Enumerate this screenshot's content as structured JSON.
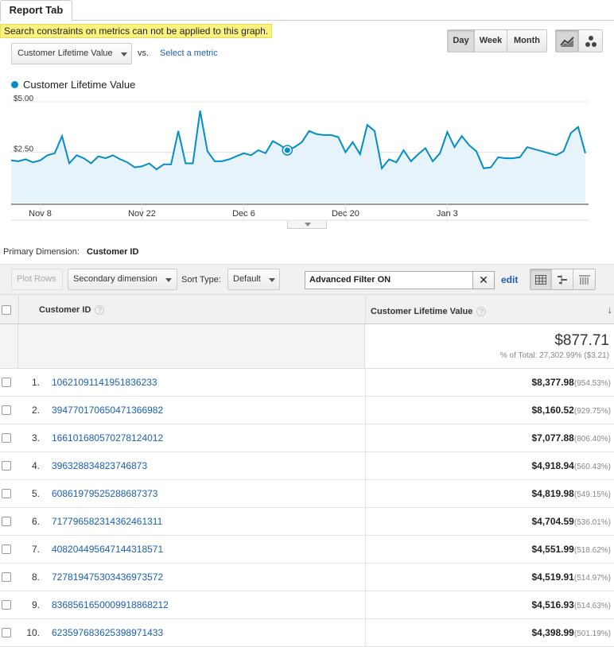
{
  "tab": {
    "label": "Report Tab"
  },
  "warning": "Search constraints on metrics can not be applied to this graph.",
  "metric_selector": {
    "value": "Customer Lifetime Value",
    "vs": "vs.",
    "select_metric": "Select a metric"
  },
  "period_buttons": [
    "Day",
    "Week",
    "Month"
  ],
  "active_period": "Day",
  "chart_type_icons": [
    "line-chart-icon",
    "motion-chart-icon"
  ],
  "legend": {
    "label": "Customer Lifetime Value",
    "color": "#058dc7"
  },
  "chart_data": {
    "type": "area",
    "y_ticks": [
      "$5.00",
      "$2.50"
    ],
    "ylim": [
      0,
      5.0
    ],
    "x_ticks": [
      "Nov 8",
      "Nov 22",
      "Dec 6",
      "Dec 20",
      "Jan 3"
    ],
    "series": [
      {
        "name": "Customer Lifetime Value",
        "color": "#058dc7",
        "values": [
          2.1,
          2.05,
          2.15,
          2.0,
          2.1,
          2.35,
          2.45,
          3.3,
          1.95,
          2.35,
          2.2,
          1.95,
          2.3,
          2.2,
          2.35,
          2.15,
          2.0,
          1.75,
          1.8,
          1.95,
          1.65,
          1.9,
          1.9,
          3.55,
          1.95,
          1.95,
          4.55,
          2.55,
          2.05,
          2.05,
          2.15,
          2.3,
          2.45,
          2.35,
          2.6,
          2.45,
          3.05,
          2.85,
          2.6,
          2.75,
          3.0,
          3.55,
          3.4,
          3.35,
          3.35,
          3.25,
          2.5,
          3.0,
          2.4,
          3.85,
          3.55,
          1.7,
          2.15,
          2.0,
          2.6,
          2.05,
          2.4,
          2.7,
          2.05,
          2.45,
          3.5,
          2.75,
          3.3,
          2.85,
          2.55,
          1.7,
          1.75,
          2.25,
          2.2,
          2.2,
          2.25,
          2.75,
          2.65,
          2.55,
          2.45,
          2.35,
          2.55,
          3.45,
          3.75,
          2.45
        ]
      }
    ],
    "highlight_index": 38
  },
  "primary_dimension": {
    "label": "Primary Dimension:",
    "value": "Customer ID"
  },
  "toolbar": {
    "plot_rows": "Plot Rows",
    "secondary_dimension": "Secondary dimension",
    "sort_type_label": "Sort Type:",
    "sort_type_value": "Default",
    "filter_value": "Advanced Filter ON",
    "filter_clear": "✕",
    "edit": "edit"
  },
  "table": {
    "col_customer_id": "Customer ID",
    "col_metric": "Customer Lifetime Value",
    "help": "?",
    "sort_arrow": "↓",
    "total_value": "$877.71",
    "total_pct": "% of Total: 27,302.99% ($3.21)",
    "rows": [
      {
        "rank": "1.",
        "id": "10621091141951836233",
        "value": "$8,377.98",
        "pct": "(954.53%)"
      },
      {
        "rank": "2.",
        "id": "3947701706504713669­82",
        "value": "$8,160.52",
        "pct": "(929.75%)"
      },
      {
        "rank": "3.",
        "id": "16610168057027812401­2",
        "value": "$7,077.88",
        "pct": "(806.40%)"
      },
      {
        "rank": "4.",
        "id": "396328834823746873",
        "value": "$4,918.94",
        "pct": "(560.43%)"
      },
      {
        "rank": "5.",
        "id": "6086197952528868737­3",
        "value": "$4,819.98",
        "pct": "(549.15%)"
      },
      {
        "rank": "6.",
        "id": "71779658231436246131­1",
        "value": "$4,704.59",
        "pct": "(536.01%)"
      },
      {
        "rank": "7.",
        "id": "4082044956471443185­71",
        "value": "$4,551.99",
        "pct": "(518.62%)"
      },
      {
        "rank": "8.",
        "id": "7278194753034369735­72",
        "value": "$4,519.91",
        "pct": "(514.97%)"
      },
      {
        "rank": "9.",
        "id": "8368561650009918868­212",
        "value": "$4,516.93",
        "pct": "(514.63%)"
      },
      {
        "rank": "10.",
        "id": "62359768362539897143­3",
        "value": "$4,398.99",
        "pct": "(501.19%)"
      }
    ]
  }
}
